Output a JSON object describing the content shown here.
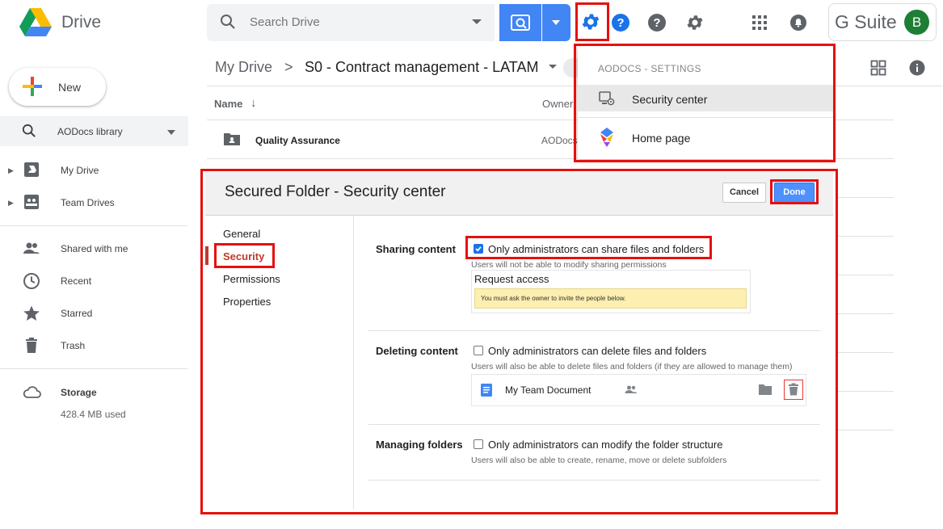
{
  "app": {
    "title": "Drive"
  },
  "search": {
    "placeholder": "Search Drive"
  },
  "gsuite": {
    "label": "G Suite",
    "avatar_initial": "B"
  },
  "breadcrumb": {
    "root": "My Drive",
    "separator": ">",
    "current": "S0 - Contract management - LATAM"
  },
  "file_list": {
    "columns": {
      "name": "Name",
      "owner": "Owner",
      "sort_arrow": "↓"
    },
    "rows": [
      {
        "name": "Quality Assurance",
        "owner": "AODocs"
      }
    ]
  },
  "sidebar": {
    "new_label": "New",
    "library": "AODocs library",
    "items": [
      {
        "label": "My Drive"
      },
      {
        "label": "Team Drives"
      },
      {
        "label": "Shared with me"
      },
      {
        "label": "Recent"
      },
      {
        "label": "Starred"
      },
      {
        "label": "Trash"
      }
    ],
    "storage": {
      "label": "Storage",
      "used": "428.4 MB used"
    }
  },
  "dropdown": {
    "header": "AODOCS - SETTINGS",
    "items": [
      {
        "label": "Security center"
      },
      {
        "label": "Home page"
      }
    ]
  },
  "dialog": {
    "title": "Secured Folder - Security center",
    "cancel_label": "Cancel",
    "done_label": "Done",
    "tabs": [
      {
        "label": "General"
      },
      {
        "label": "Security"
      },
      {
        "label": "Permissions"
      },
      {
        "label": "Properties"
      }
    ],
    "sections": {
      "sharing": {
        "label": "Sharing content",
        "checkbox_label": "Only administrators can share files and folders",
        "checked": true,
        "hint": "Users will not be able to modify sharing permissions",
        "preview_title": "Request access",
        "preview_warning": "You must ask the owner to invite the people below."
      },
      "deleting": {
        "label": "Deleting content",
        "checkbox_label": "Only administrators can delete files and folders",
        "checked": false,
        "hint": "Users will also be able to delete files and folders (if they are allowed to manage them)",
        "doc_name": "My Team Document"
      },
      "folders": {
        "label": "Managing folders",
        "checkbox_label": "Only administrators can modify the folder structure",
        "checked": false,
        "hint": "Users will also be able to create, rename, move or delete subfolders"
      }
    }
  },
  "colors": {
    "accent_blue": "#4285f4",
    "highlight_red": "#e6100d",
    "active_tab": "#c0392b"
  }
}
